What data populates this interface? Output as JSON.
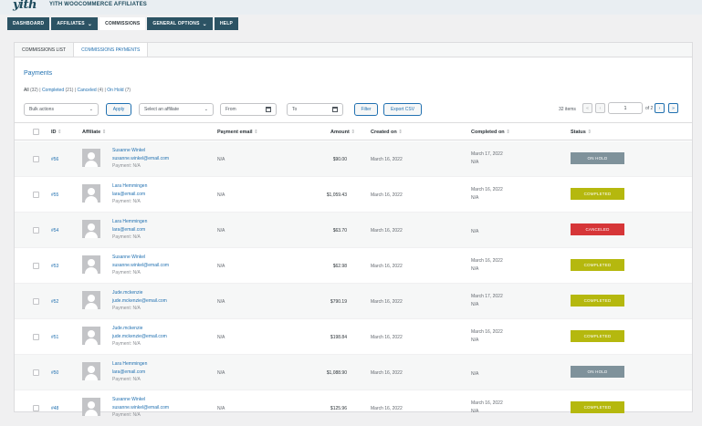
{
  "brand": {
    "logo": "yith",
    "title": "YITH WOOCOMMERCE AFFILIATES"
  },
  "nav": [
    {
      "label": "DASHBOARD",
      "dropdown": false,
      "active": false
    },
    {
      "label": "AFFILIATES",
      "dropdown": true,
      "active": false
    },
    {
      "label": "COMMISSIONS",
      "dropdown": false,
      "active": true
    },
    {
      "label": "GENERAL OPTIONS",
      "dropdown": true,
      "active": false
    },
    {
      "label": "HELP",
      "dropdown": false,
      "active": false
    }
  ],
  "subtabs": [
    {
      "label": "COMMISSIONS LIST",
      "active": false
    },
    {
      "label": "COMMISSIONS PAYMENTS",
      "active": true
    }
  ],
  "page_title": "Payments",
  "views": [
    {
      "label": "All",
      "count": "(32)",
      "current": true
    },
    {
      "label": "Completed",
      "count": "(21)",
      "current": false
    },
    {
      "label": "Canceled",
      "count": "(4)",
      "current": false
    },
    {
      "label": "On Hold",
      "count": "(7)",
      "current": false
    }
  ],
  "filters": {
    "bulk_actions": "Bulk actions",
    "apply": "Apply",
    "affiliate_placeholder": "Select an affiliate",
    "from_placeholder": "From",
    "to_placeholder": "To",
    "filter": "Filter",
    "export": "Export CSV"
  },
  "pagination": {
    "items": "32 items",
    "first": "«",
    "prev": "‹",
    "current": "1",
    "of": "of 2",
    "next": "›",
    "last": "»"
  },
  "columns": {
    "id": "ID",
    "affiliate": "Affiliate",
    "payment_email": "Payment email",
    "amount": "Amount",
    "created_on": "Created on",
    "completed_on": "Completed on",
    "status": "Status",
    "sort_icon": "⇕"
  },
  "status_colors": {
    "ON HOLD": "#7f929b",
    "COMPLETED": "#b5b80e",
    "CANCELED": "#d63638"
  },
  "rows": [
    {
      "id": "#56",
      "name": "Susanne Winkel",
      "email": "susanne.winkel@email.com",
      "payment": "Payment: N/A",
      "payment_email": "N/A",
      "amount": "$90.00",
      "created": "March 16, 2022",
      "completed_date": "March 17, 2022",
      "completed_sub": "N/A",
      "status": "ON HOLD"
    },
    {
      "id": "#55",
      "name": "Lara Hemmingen",
      "email": "lara@email.com",
      "payment": "Payment: N/A",
      "payment_email": "N/A",
      "amount": "$1,059.43",
      "created": "March 16, 2022",
      "completed_date": "March 16, 2022",
      "completed_sub": "N/A",
      "status": "COMPLETED"
    },
    {
      "id": "#54",
      "name": "Lara Hemmingen",
      "email": "lara@email.com",
      "payment": "Payment: N/A",
      "payment_email": "N/A",
      "amount": "$63.70",
      "created": "March 16, 2022",
      "completed_date": "N/A",
      "completed_sub": "",
      "status": "CANCELED"
    },
    {
      "id": "#53",
      "name": "Susanne Winkel",
      "email": "susanne.winkel@email.com",
      "payment": "Payment: N/A",
      "payment_email": "N/A",
      "amount": "$62.98",
      "created": "March 16, 2022",
      "completed_date": "March 16, 2022",
      "completed_sub": "N/A",
      "status": "COMPLETED"
    },
    {
      "id": "#52",
      "name": "Jude.mckenzie",
      "email": "jude.mckenzie@email.com",
      "payment": "Payment: N/A",
      "payment_email": "N/A",
      "amount": "$790.19",
      "created": "March 16, 2022",
      "completed_date": "March 17, 2022",
      "completed_sub": "N/A",
      "status": "COMPLETED"
    },
    {
      "id": "#51",
      "name": "Jude.mckenzie",
      "email": "jude.mckenzie@email.com",
      "payment": "Payment: N/A",
      "payment_email": "N/A",
      "amount": "$198.84",
      "created": "March 16, 2022",
      "completed_date": "March 16, 2022",
      "completed_sub": "N/A",
      "status": "COMPLETED"
    },
    {
      "id": "#50",
      "name": "Lara Hemmingen",
      "email": "lara@email.com",
      "payment": "Payment: N/A",
      "payment_email": "N/A",
      "amount": "$1,088.90",
      "created": "March 16, 2022",
      "completed_date": "N/A",
      "completed_sub": "",
      "status": "ON HOLD"
    },
    {
      "id": "#48",
      "name": "Susanne Winkel",
      "email": "susanne.winkel@email.com",
      "payment": "Payment: N/A",
      "payment_email": "N/A",
      "amount": "$125.96",
      "created": "March 16, 2022",
      "completed_date": "March 16, 2022",
      "completed_sub": "N/A",
      "status": "COMPLETED"
    }
  ]
}
